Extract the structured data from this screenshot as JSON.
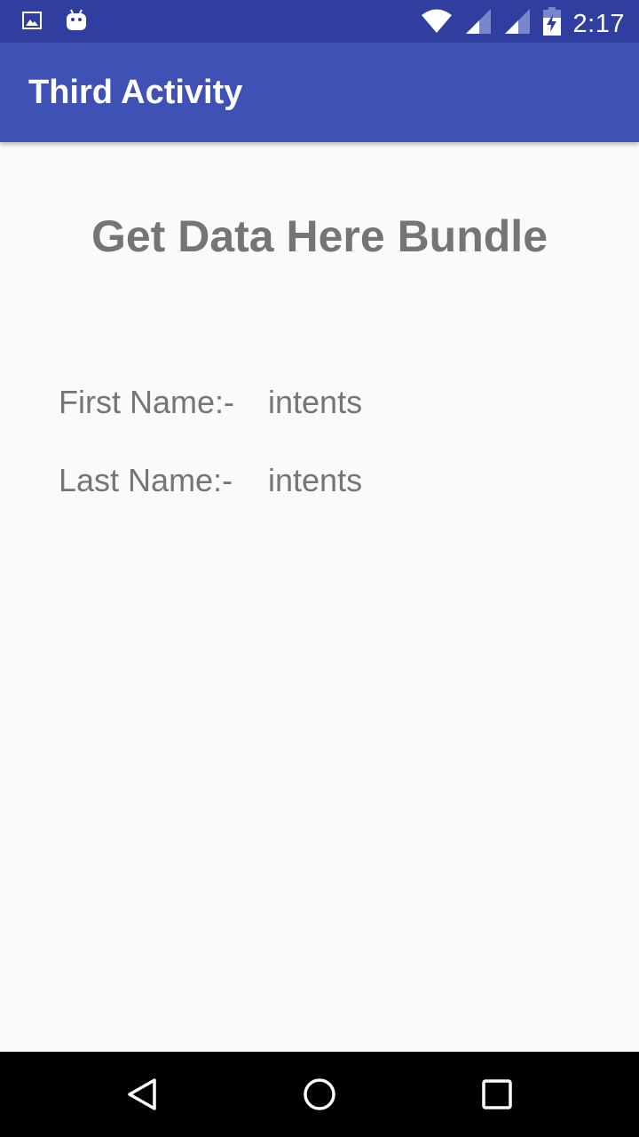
{
  "status_bar": {
    "time": "2:17",
    "icons": [
      "image-notification-icon",
      "android-notification-icon",
      "wifi-icon",
      "signal-icon",
      "signal-icon",
      "battery-charging-icon"
    ]
  },
  "app_bar": {
    "title": "Third Activity"
  },
  "main": {
    "heading": "Get Data Here Bundle",
    "first_name_label": "First Name:-",
    "first_name_value": "intents",
    "last_name_label": "Last Name:-",
    "last_name_value": "intents"
  },
  "nav_bar": {
    "buttons": [
      "back",
      "home",
      "recents"
    ]
  },
  "colors": {
    "status_bar": "#303f9f",
    "app_bar": "#3f51b5",
    "text": "#757575",
    "background": "#fafafa"
  }
}
